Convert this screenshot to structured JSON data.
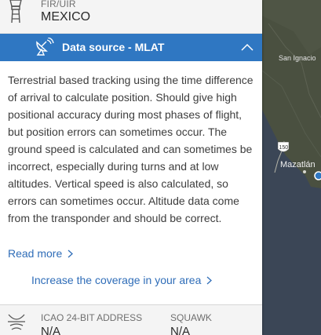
{
  "fir": {
    "label": "FIR/UIR",
    "value": "MEXICO",
    "icon": "control-tower-icon"
  },
  "data_source": {
    "title": "Data source - MLAT",
    "icon": "satellite-dish-icon",
    "chevron": "chevron-up-icon",
    "description": "Terrestrial based tracking using the time difference of arrival to calculate position. Should give high positional accuracy during most phases of flight, but position errors can sometimes occur. The ground speed is calculated and can sometimes be incorrect, especially during turns and at low altitudes. Vertical speed is also calculated, so errors can sometimes occur. Altitude data come from the transponder and should be correct.",
    "read_more": "Read more",
    "coverage_link": "Increase the coverage in your area"
  },
  "aircraft": {
    "icon": "radar-icon",
    "icao_label": "ICAO 24-BIT ADDRESS",
    "icao_value": "N/A",
    "squawk_label": "SQUAWK",
    "squawk_value": "N/A"
  },
  "map": {
    "labels": [
      "San Ignacio",
      "Mazatlán"
    ],
    "highway_shield": "150",
    "colors": {
      "land": "#4a5040",
      "sea": "#3b4656",
      "accent": "#2f77c2"
    }
  }
}
